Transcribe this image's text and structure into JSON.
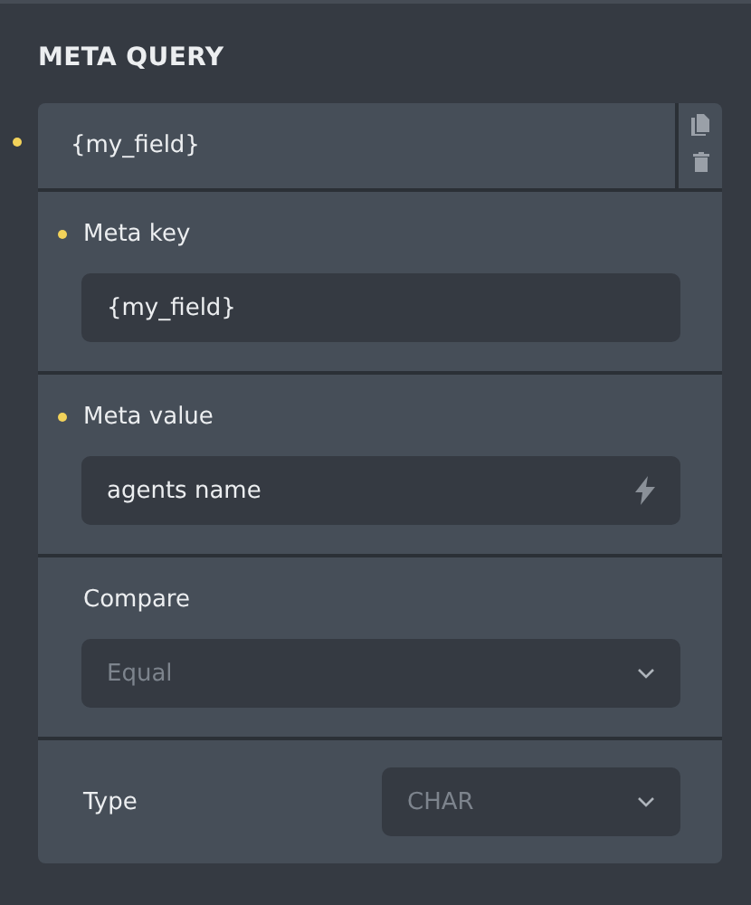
{
  "title": "META QUERY",
  "query": {
    "label": "{my_field}",
    "changed": true,
    "fields": [
      {
        "kind": "input",
        "label": "Meta key",
        "changed": true,
        "value": "{my_field}"
      },
      {
        "kind": "dynamic",
        "label": "Meta value",
        "changed": true,
        "value": "agents name"
      },
      {
        "kind": "select",
        "label": "Compare",
        "changed": false,
        "placeholder": "Equal"
      },
      {
        "kind": "inline-select",
        "label": "Type",
        "changed": false,
        "placeholder": "CHAR"
      }
    ]
  }
}
